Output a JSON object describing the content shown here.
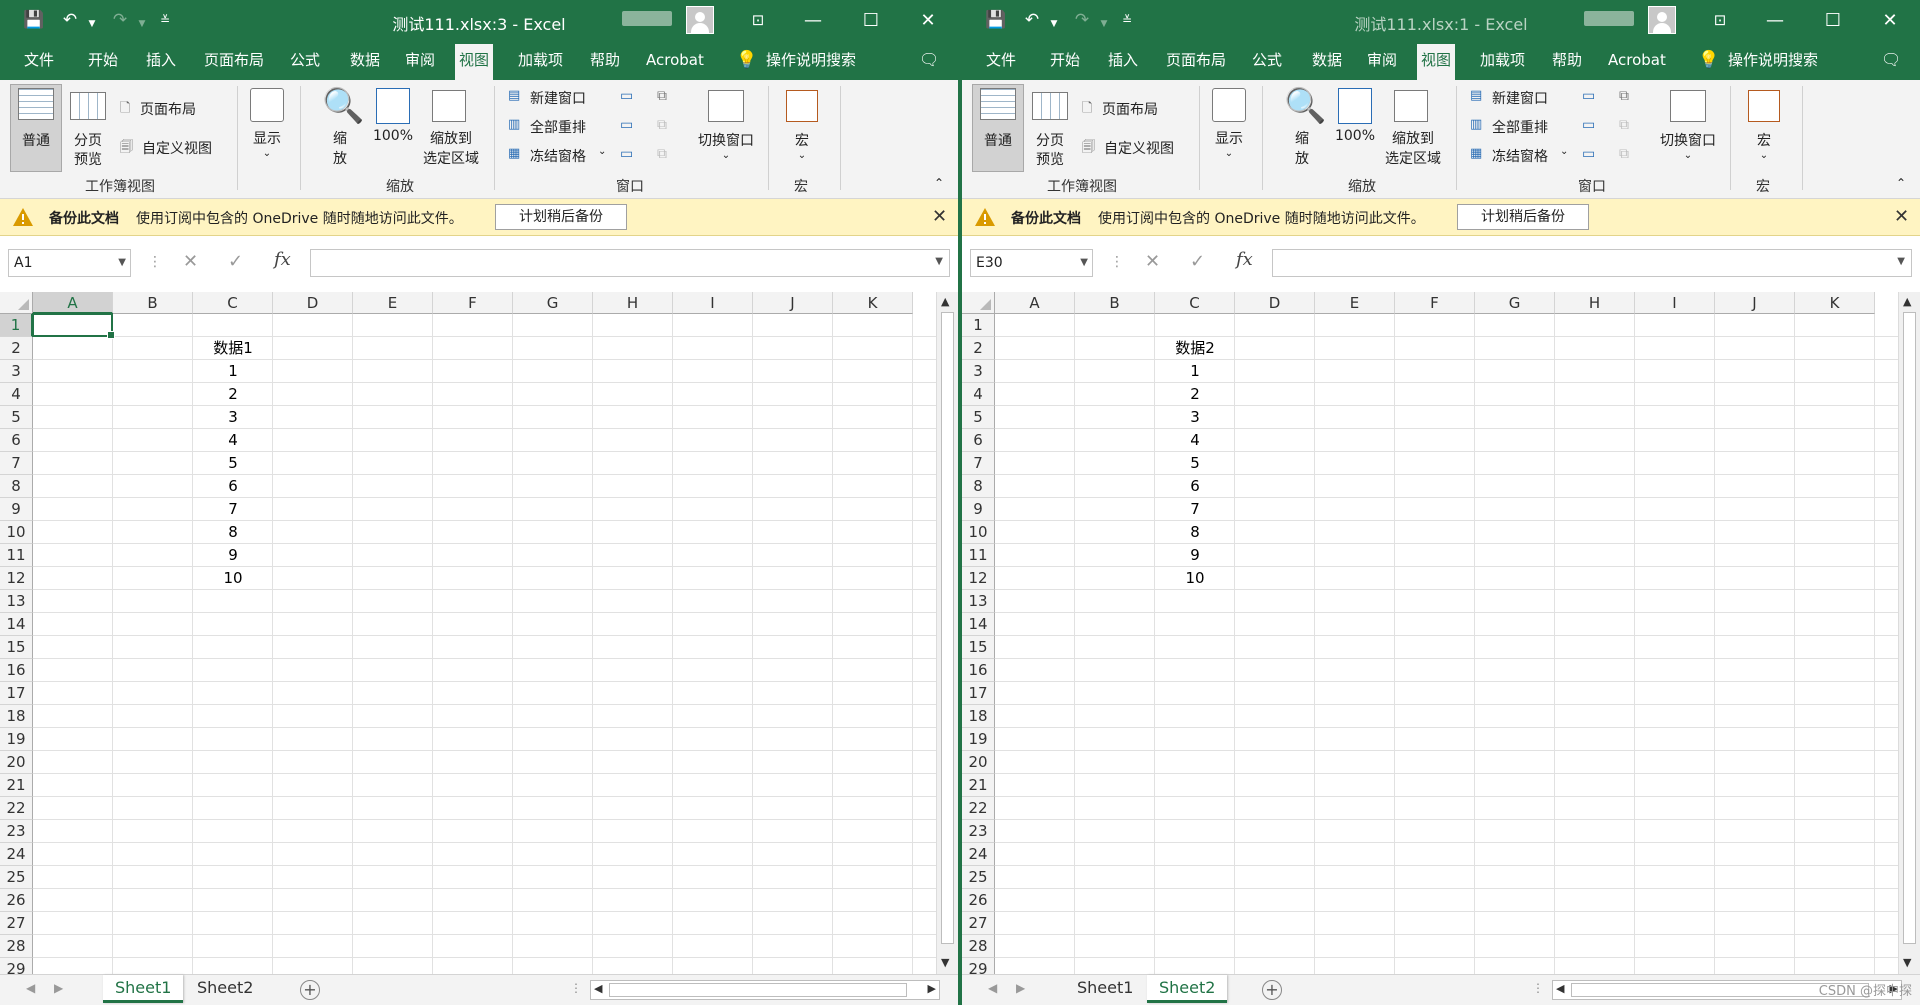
{
  "colors": {
    "brand": "#217346",
    "ribbon_bg": "#f3f3f3",
    "notice_bg": "#fff4c2"
  },
  "ribbon_tabs": [
    "文件",
    "开始",
    "插入",
    "页面布局",
    "公式",
    "数据",
    "审阅",
    "视图",
    "加载项",
    "帮助",
    "Acrobat"
  ],
  "active_tab": "视图",
  "tell_me": "操作说明搜索",
  "ribbon": {
    "normal": "普通",
    "page_break_preview_1": "分页",
    "page_break_preview_2": "预览",
    "page_layout": "页面布局",
    "custom_views": "自定义视图",
    "workbook_views_group": "工作簿视图",
    "show": "显示",
    "zoom_1": "缩",
    "zoom_2": "放",
    "zoom_100": "100%",
    "zoom_to_sel_1": "缩放到",
    "zoom_to_sel_2": "选定区域",
    "zoom_group": "缩放",
    "new_window": "新建窗口",
    "arrange_all": "全部重排",
    "freeze_panes": "冻结窗格",
    "switch_windows": "切换窗口",
    "window_group": "窗口",
    "macros": "宏",
    "macros_group": "宏"
  },
  "notice": {
    "bold": "备份此文档",
    "message": "使用订阅中包含的 OneDrive 随时随地访问此文件。",
    "button": "计划稍后备份"
  },
  "columns": [
    "A",
    "B",
    "C",
    "D",
    "E",
    "F",
    "G",
    "H",
    "I",
    "J",
    "K"
  ],
  "rows": [
    "1",
    "2",
    "3",
    "4",
    "5",
    "6",
    "7",
    "8",
    "9",
    "10",
    "11",
    "12",
    "13",
    "14",
    "15",
    "16",
    "17",
    "18",
    "19",
    "20",
    "21",
    "22",
    "23",
    "24",
    "25",
    "26",
    "27",
    "28",
    "29"
  ],
  "sheets": [
    "Sheet1",
    "Sheet2"
  ],
  "left": {
    "title": "测试111.xlsx:3  -  Excel",
    "namebox": "A1",
    "header": "数据1",
    "values": [
      "1",
      "2",
      "3",
      "4",
      "5",
      "6",
      "7",
      "8",
      "9",
      "10"
    ],
    "active_sheet": "Sheet1"
  },
  "right": {
    "title": "测试111.xlsx:1  -  Excel",
    "namebox": "E30",
    "header": "数据2",
    "values": [
      "1",
      "2",
      "3",
      "4",
      "5",
      "6",
      "7",
      "8",
      "9",
      "10"
    ],
    "active_sheet": "Sheet2"
  },
  "watermark": "CSDN @探中探"
}
